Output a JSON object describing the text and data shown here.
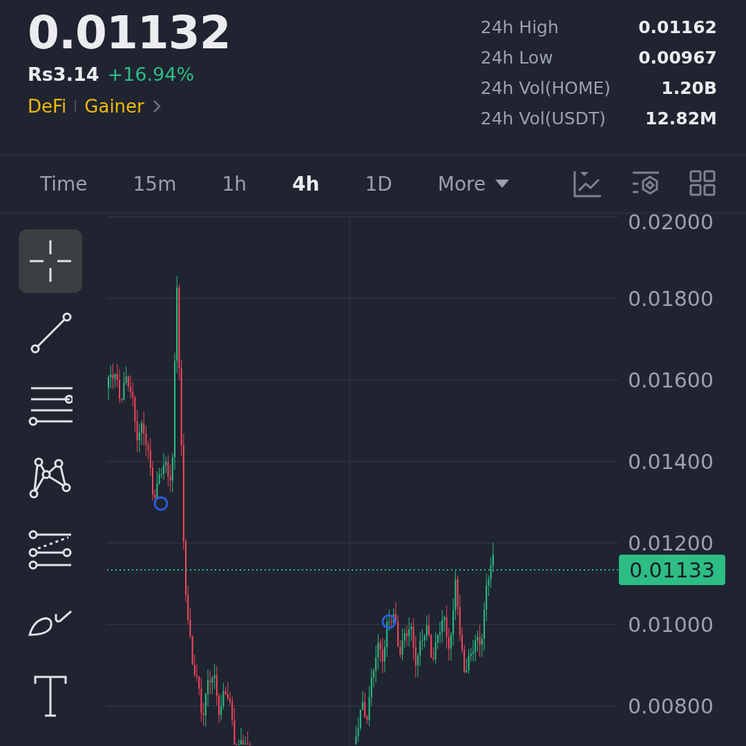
{
  "header": {
    "price": "0.01132",
    "local_price": "Rs3.14",
    "change": "+16.94%",
    "tags": [
      "DeFi",
      "Gainer"
    ]
  },
  "stats": [
    {
      "label": "24h High",
      "value": "0.01162"
    },
    {
      "label": "24h Low",
      "value": "0.00967"
    },
    {
      "label": "24h Vol(HOME)",
      "value": "1.20B"
    },
    {
      "label": "24h Vol(USDT)",
      "value": "12.82M"
    }
  ],
  "intervals": [
    {
      "label": "Time",
      "selected": false
    },
    {
      "label": "15m",
      "selected": false
    },
    {
      "label": "1h",
      "selected": false
    },
    {
      "label": "4h",
      "selected": true
    },
    {
      "label": "1D",
      "selected": false
    },
    {
      "label": "More",
      "selected": false,
      "dropdown": true
    }
  ],
  "tools": [
    {
      "kind": "crosshair",
      "selected": true
    },
    {
      "kind": "trend-line",
      "selected": false
    },
    {
      "kind": "parallel-lines",
      "selected": false
    },
    {
      "kind": "pattern",
      "selected": false
    },
    {
      "kind": "fib",
      "selected": false
    },
    {
      "kind": "brush",
      "selected": false
    },
    {
      "kind": "text",
      "selected": false
    }
  ],
  "price_axis": [
    "0.02000",
    "0.01800",
    "0.01600",
    "0.01400",
    "0.01200",
    "0.01000",
    "0.00800"
  ],
  "current_price_tag": "0.01133"
}
